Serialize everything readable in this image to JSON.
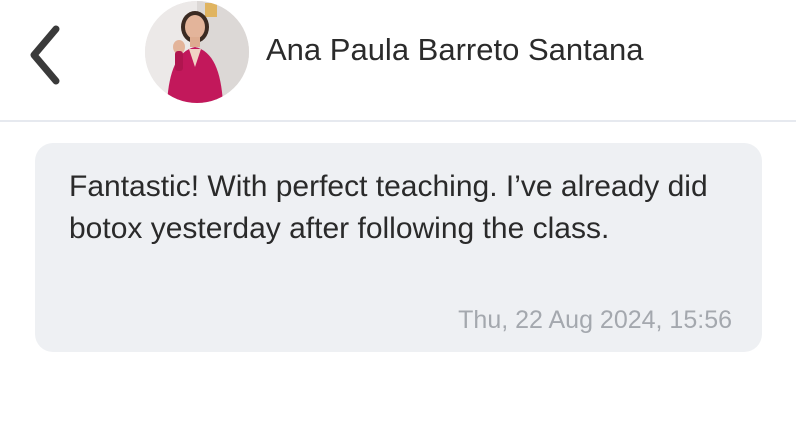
{
  "header": {
    "back_icon": "chevron-left-icon",
    "contact_name": "Ana Paula Barreto Santana",
    "avatar_icon": "contact-avatar"
  },
  "messages": [
    {
      "text": "Fantastic! With perfect teaching. I’ve already did botox yesterday after following the class.",
      "timestamp": "Thu, 22 Aug 2024, 15:56"
    }
  ],
  "colors": {
    "bubble_background": "#eef0f3",
    "timestamp": "#a4a8ae",
    "name_text": "#2b2b2b",
    "divider": "#e6e9ef"
  }
}
